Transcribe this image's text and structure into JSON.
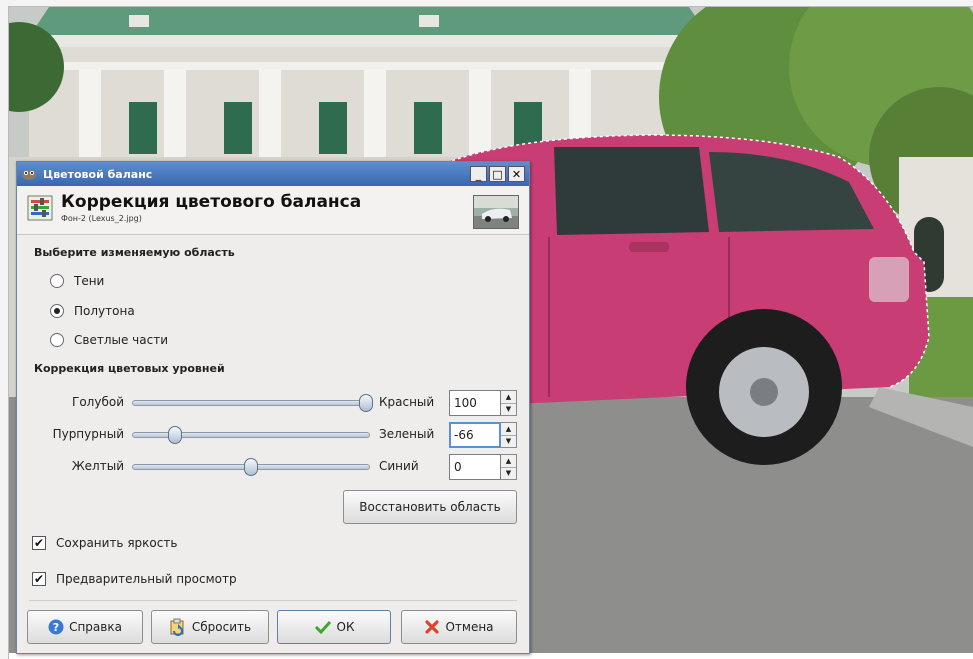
{
  "dialog": {
    "window_title": "Цветовой баланс",
    "header_title": "Коррекция цветового баланса",
    "header_subtitle": "Фон-2 (Lexus_2.jpg)",
    "range_section": "Выберите изменяемую область",
    "ranges": [
      {
        "label": "Тени",
        "checked": false
      },
      {
        "label": "Полутона",
        "checked": true
      },
      {
        "label": "Светлые части",
        "checked": false
      }
    ],
    "levels_section": "Коррекция цветовых уровней",
    "sliders": [
      {
        "left": "Голубой",
        "right": "Красный",
        "value": "100",
        "level": 100
      },
      {
        "left": "Пурпурный",
        "right": "Зеленый",
        "value": "-66",
        "level": -66
      },
      {
        "left": "Желтый",
        "right": "Синий",
        "value": "0",
        "level": 0
      }
    ],
    "reset_range_button": "Восстановить область",
    "preserve_luminosity": "Сохранить яркость",
    "preview": "Предварительный просмотр",
    "buttons": {
      "help": "Справка",
      "reset": "Сбросить",
      "ok": "ОК",
      "cancel": "Отмена"
    }
  },
  "colors": {
    "titlebar": "#4a7cc2",
    "car_body": "#c83d74",
    "dialog_bg": "#eeedeb"
  },
  "icons": [
    "gimp-icon",
    "color-balance-icon",
    "help-icon",
    "reset-icon",
    "ok-check-icon",
    "cancel-x-icon"
  ]
}
